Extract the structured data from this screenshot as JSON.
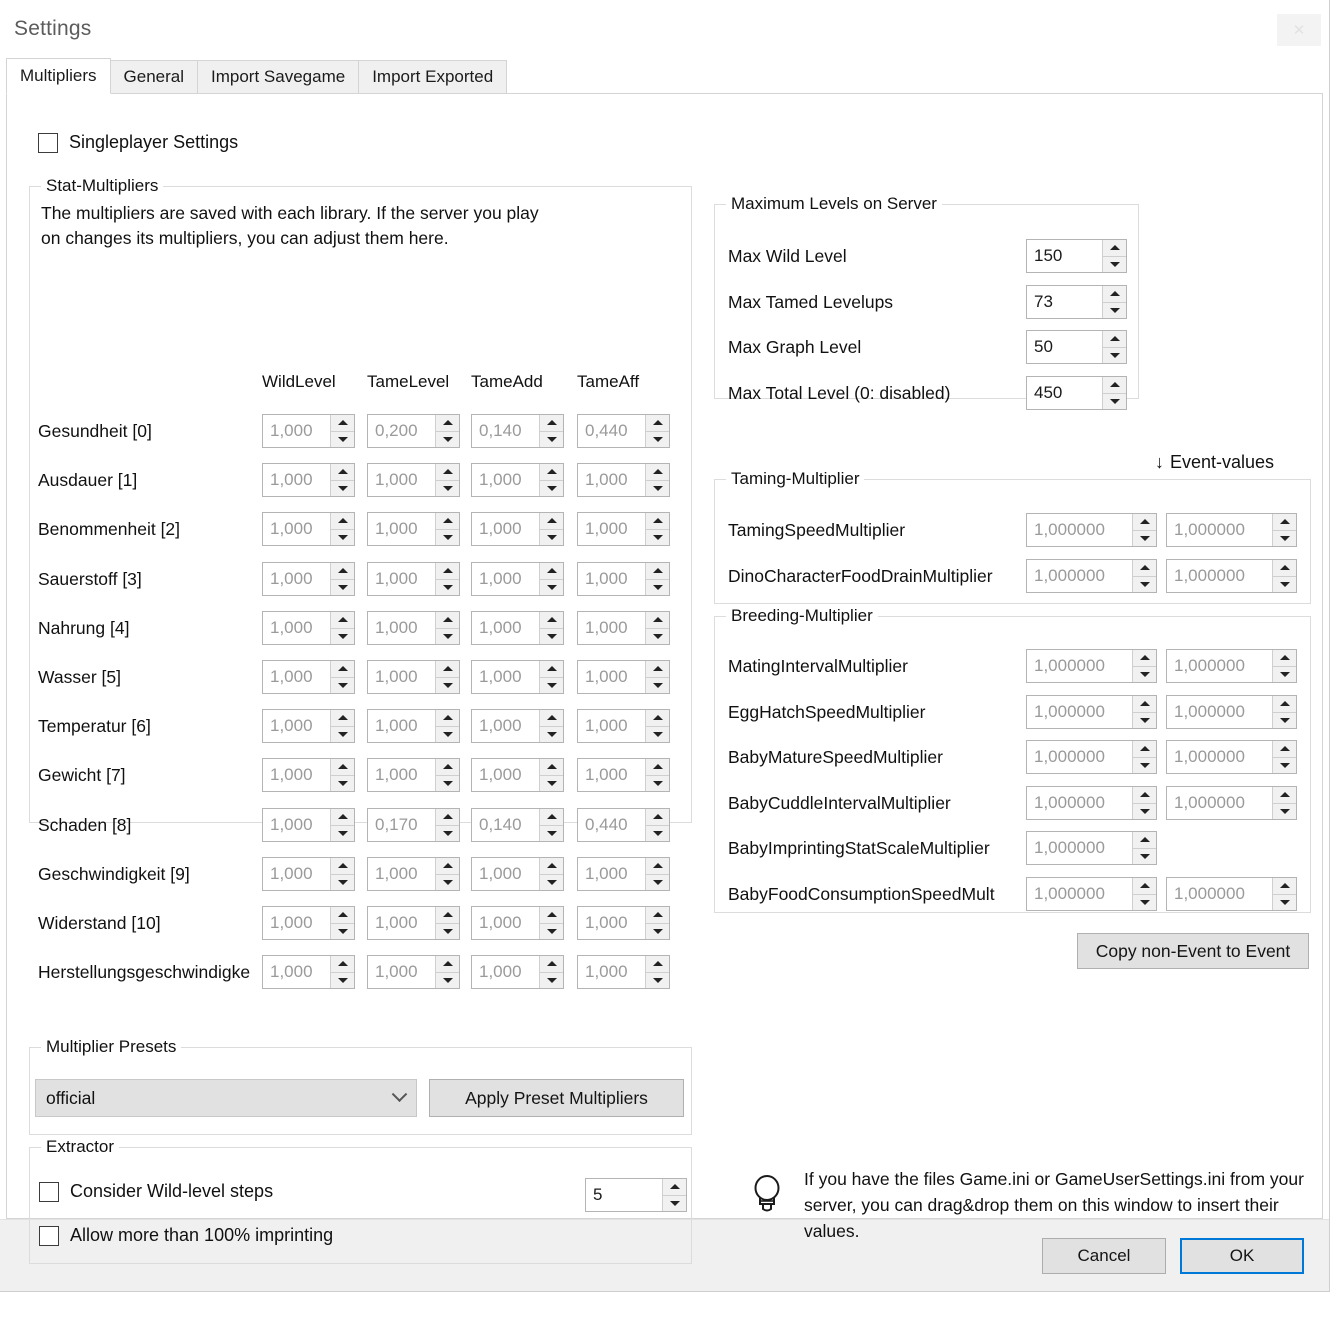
{
  "window": {
    "title": "Settings",
    "close_label": "✕"
  },
  "tabs": [
    {
      "label": "Multipliers",
      "active": true
    },
    {
      "label": "General",
      "active": false
    },
    {
      "label": "Import Savegame",
      "active": false
    },
    {
      "label": "Import Exported",
      "active": false
    }
  ],
  "singleplayer": {
    "label": "Singleplayer Settings",
    "checked": false
  },
  "stat_multipliers": {
    "group_label": "Stat-Multipliers",
    "note": "The multipliers are saved with each library. If the server you play\non changes its multipliers, you can adjust them here.",
    "columns": [
      "WildLevel",
      "TameLevel",
      "TameAdd",
      "TameAff"
    ],
    "rows": [
      {
        "label": "Gesundheit [0]",
        "values": [
          "1,000",
          "0,200",
          "0,140",
          "0,440"
        ]
      },
      {
        "label": "Ausdauer [1]",
        "values": [
          "1,000",
          "1,000",
          "1,000",
          "1,000"
        ]
      },
      {
        "label": "Benommenheit [2]",
        "values": [
          "1,000",
          "1,000",
          "1,000",
          "1,000"
        ]
      },
      {
        "label": "Sauerstoff [3]",
        "values": [
          "1,000",
          "1,000",
          "1,000",
          "1,000"
        ]
      },
      {
        "label": "Nahrung [4]",
        "values": [
          "1,000",
          "1,000",
          "1,000",
          "1,000"
        ]
      },
      {
        "label": "Wasser [5]",
        "values": [
          "1,000",
          "1,000",
          "1,000",
          "1,000"
        ]
      },
      {
        "label": "Temperatur [6]",
        "values": [
          "1,000",
          "1,000",
          "1,000",
          "1,000"
        ]
      },
      {
        "label": "Gewicht [7]",
        "values": [
          "1,000",
          "1,000",
          "1,000",
          "1,000"
        ]
      },
      {
        "label": "Schaden [8]",
        "values": [
          "1,000",
          "0,170",
          "0,140",
          "0,440"
        ]
      },
      {
        "label": "Geschwindigkeit [9]",
        "values": [
          "1,000",
          "1,000",
          "1,000",
          "1,000"
        ]
      },
      {
        "label": "Widerstand [10]",
        "values": [
          "1,000",
          "1,000",
          "1,000",
          "1,000"
        ]
      },
      {
        "label": "Herstellungsgeschwindigke",
        "values": [
          "1,000",
          "1,000",
          "1,000",
          "1,000"
        ]
      }
    ]
  },
  "presets": {
    "group_label": "Multiplier Presets",
    "selected": "official",
    "apply_label": "Apply Preset Multipliers"
  },
  "extractor": {
    "group_label": "Extractor",
    "consider_steps_label": "Consider Wild-level steps",
    "consider_steps_checked": false,
    "steps_value": "5",
    "allow_imprinting_label": "Allow more than 100% imprinting",
    "allow_imprinting_checked": false
  },
  "max_levels": {
    "group_label": "Maximum Levels on Server",
    "rows": [
      {
        "label": "Max Wild Level",
        "value": "150"
      },
      {
        "label": "Max Tamed Levelups",
        "value": "73"
      },
      {
        "label": "Max Graph Level",
        "value": "50"
      },
      {
        "label": "Max Total Level (0: disabled)",
        "value": "450"
      }
    ]
  },
  "event_values_link": "Event-values",
  "event_values_arrow": "↓",
  "taming": {
    "group_label": "Taming-Multiplier",
    "rows": [
      {
        "label": "TamingSpeedMultiplier",
        "normal": "1,000000",
        "event": "1,000000"
      },
      {
        "label": "DinoCharacterFoodDrainMultiplier",
        "normal": "1,000000",
        "event": "1,000000"
      }
    ]
  },
  "breeding": {
    "group_label": "Breeding-Multiplier",
    "rows": [
      {
        "label": "MatingIntervalMultiplier",
        "normal": "1,000000",
        "event": "1,000000"
      },
      {
        "label": "EggHatchSpeedMultiplier",
        "normal": "1,000000",
        "event": "1,000000"
      },
      {
        "label": "BabyMatureSpeedMultiplier",
        "normal": "1,000000",
        "event": "1,000000"
      },
      {
        "label": "BabyCuddleIntervalMultiplier",
        "normal": "1,000000",
        "event": "1,000000"
      },
      {
        "label": "BabyImprintingStatScaleMultiplier",
        "normal": "1,000000",
        "event": null
      },
      {
        "label": "BabyFoodConsumptionSpeedMult",
        "normal": "1,000000",
        "event": "1,000000"
      }
    ]
  },
  "copy_button_label": "Copy non-Event to Event",
  "tip": {
    "icon": "lightbulb-icon",
    "text": "If you have the files Game.ini or GameUserSettings.ini from your server, you can drag&drop them on this window to insert their values."
  },
  "footer": {
    "cancel_label": "Cancel",
    "ok_label": "OK"
  },
  "colors": {
    "accent": "#0078d7",
    "window_bg": "#ffffff",
    "footer_bg": "#f0f0f0",
    "control_bg": "#e1e1e1",
    "disabled_text": "#9a9a9a"
  }
}
